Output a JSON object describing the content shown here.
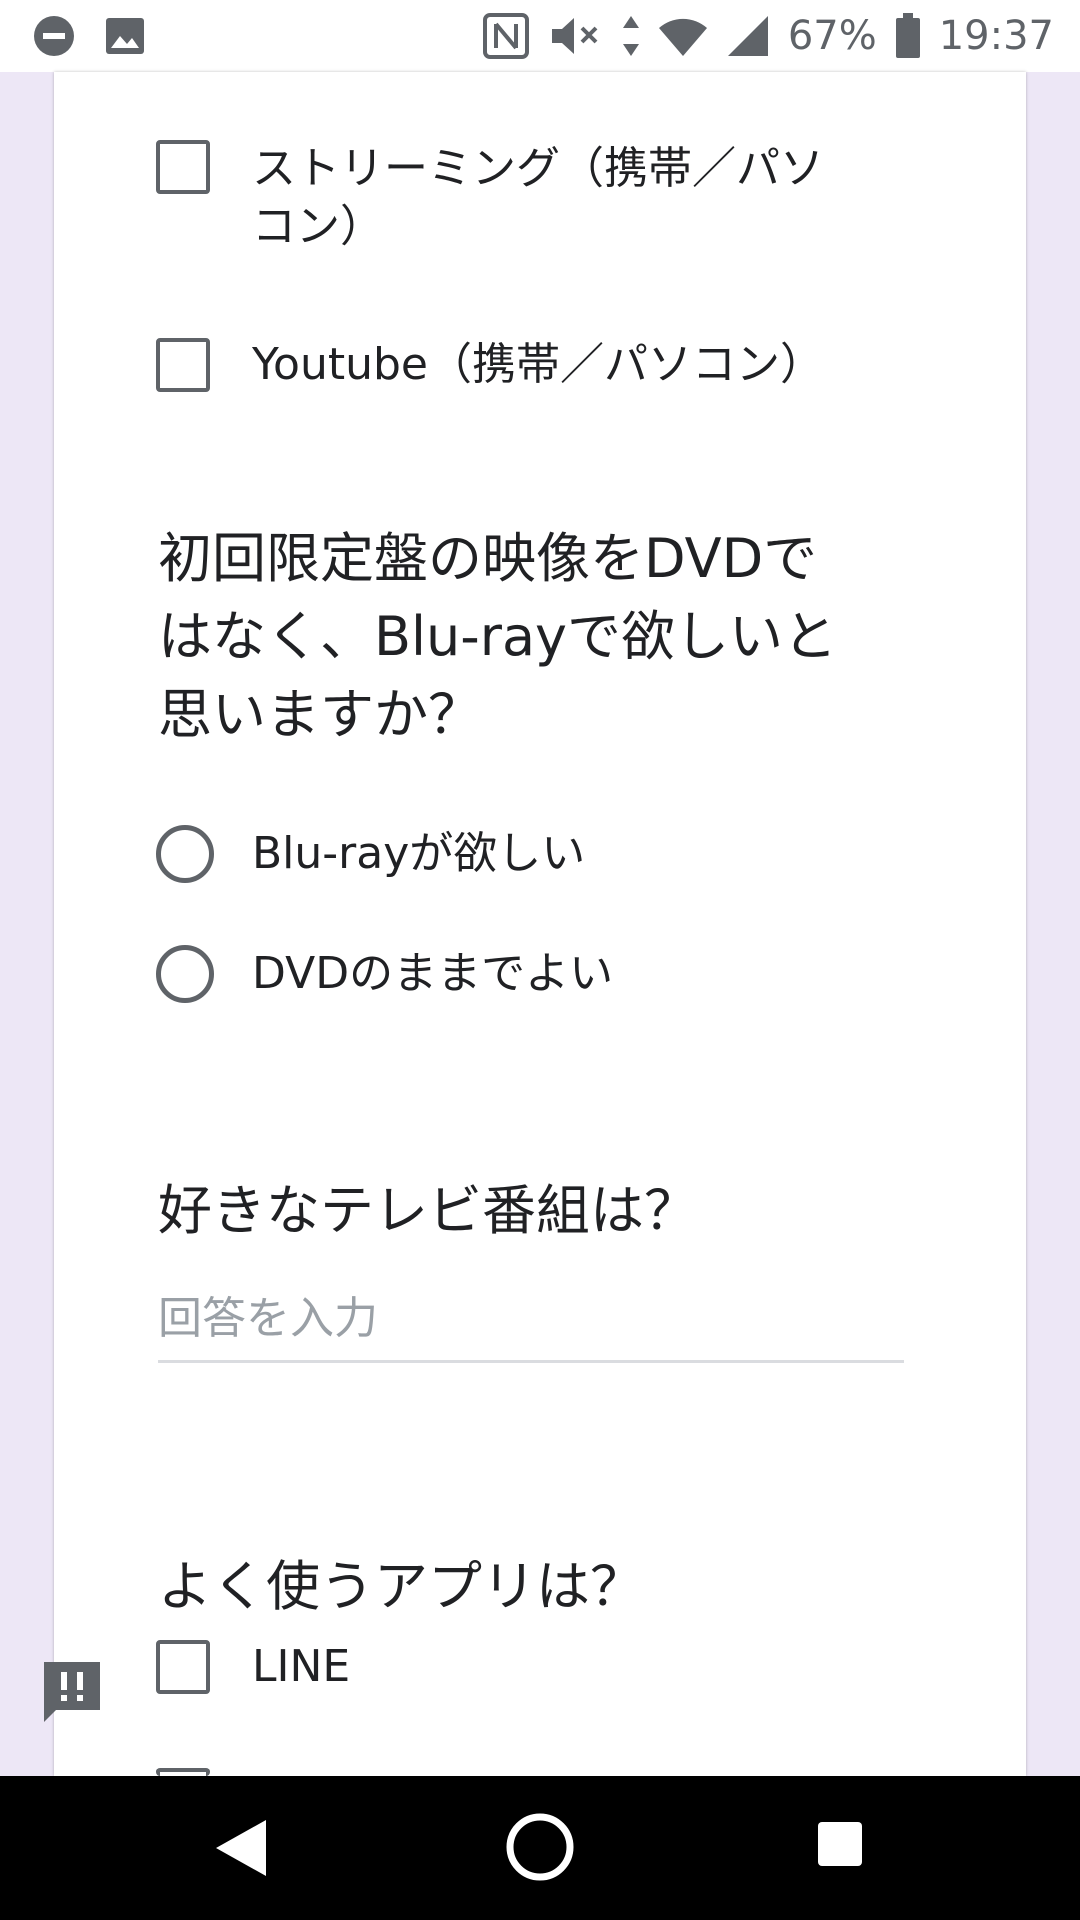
{
  "status_bar": {
    "battery_percent": "67%",
    "time": "19:37",
    "icons": [
      "dnd-icon",
      "image-icon",
      "nfc-icon",
      "mute-icon",
      "data-arrows-icon",
      "wifi-icon",
      "signal-icon",
      "battery-icon"
    ]
  },
  "form": {
    "media_options": [
      {
        "label_line1": "ストリーミング（携帯／パソ",
        "label_line2": "コン）",
        "checked": false
      },
      {
        "label": "Youtube（携帯／パソコン）",
        "checked": false
      }
    ],
    "q_bluray": {
      "title_line1": "初回限定盤の映像をDVDで",
      "title_line2": "はなく、Blu-rayで欲しいと",
      "title_line3": "思いますか？",
      "options": [
        "Blu-rayが欲しい",
        "DVDのままでよい"
      ]
    },
    "q_tv": {
      "title": "好きなテレビ番組は？",
      "placeholder": "回答を入力"
    },
    "q_apps": {
      "title": "よく使うアプリは？",
      "options": [
        "LINE"
      ]
    }
  },
  "colors": {
    "page_background": "#ede7f6",
    "card": "#ffffff",
    "control": "#5f6368",
    "placeholder": "#9aa0a6"
  },
  "feedback_icon": "report-feedback-icon",
  "nav": [
    "back-icon",
    "home-icon",
    "recents-icon"
  ]
}
